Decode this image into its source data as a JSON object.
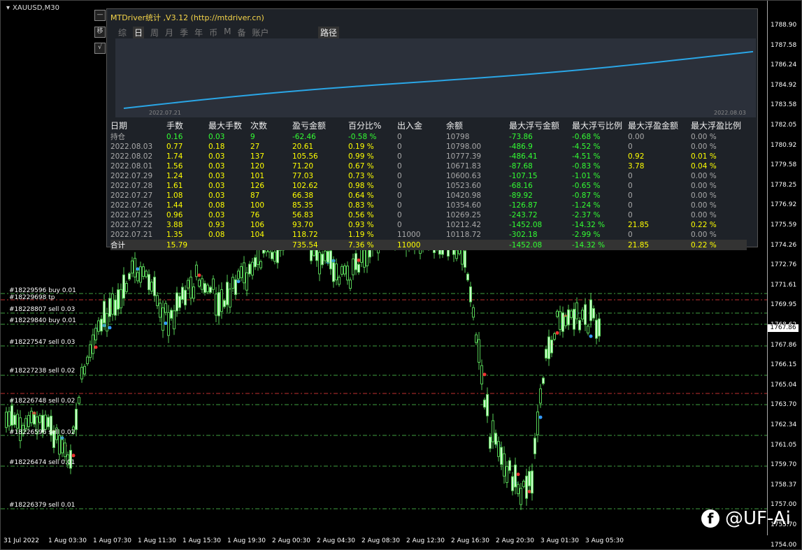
{
  "symbol": "XAUUSD,M30",
  "price_axis": [
    "1788.90",
    "1787.58",
    "1786.24",
    "1784.92",
    "1783.58",
    "1782.05",
    "1780.92",
    "1779.58",
    "1778.25",
    "1776.92",
    "1775.59",
    "1774.26",
    "1772.76",
    "1771.61",
    "1769.95",
    "1768.62",
    "1767.86",
    "1766.15",
    "1765.04",
    "1763.70",
    "1762.34",
    "1761.05",
    "1759.70",
    "1758.37",
    "1757.00",
    "1755.70",
    "1754.00"
  ],
  "current_price": "1767.86",
  "time_axis": [
    "31 Jul 2022",
    "1 Aug 03:30",
    "1 Aug 07:30",
    "1 Aug 11:30",
    "1 Aug 15:30",
    "1 Aug 19:30",
    "2 Aug 00:30",
    "2 Aug 04:30",
    "2 Aug 08:30",
    "2 Aug 12:30",
    "2 Aug 16:30",
    "2 Aug 20:30",
    "3 Aug 01:30",
    "3 Aug 05:30"
  ],
  "orders": [
    "#18229596 buy 0.01",
    "#18229698 tp",
    "#18228807 sell 0.03",
    "#18229840 buy 0.01",
    "#18227547 sell 0.03",
    "#18227238 sell 0.02",
    "#18226748 sell 0.02",
    "#18226596 sell 0.02",
    "#18226474 sell 0.01",
    "#18226379 sell 0.01"
  ],
  "watermark": "@UF-Ai",
  "watermark_icon": "facebook-icon",
  "panel": {
    "title": "MTDriver统计 ,V3.12 (http://mtdriver.cn)",
    "tabs": [
      "综",
      "日",
      "周",
      "月",
      "季",
      "年",
      "币",
      "M",
      "备",
      "账户"
    ],
    "active_tab": "日",
    "path_tab": "路径",
    "side_buttons": [
      "—",
      "移",
      "√"
    ],
    "graph_start": "2022.07.21",
    "graph_end": "2022.08.03",
    "headers": [
      "日期",
      "手数",
      "最大手数",
      "次数",
      "盈亏金额",
      "百分比%",
      "出入金",
      "余额",
      "最大浮亏金额",
      "最大浮亏比例",
      "最大浮盈金额",
      "最大浮盈比例"
    ],
    "rows": [
      [
        "持仓",
        "0.16",
        "0.03",
        "9",
        "-62.46",
        "-0.58 %",
        "0",
        "10798",
        "-73.86",
        "-0.68 %",
        "0.00",
        "0.00 %"
      ],
      [
        "2022.08.03",
        "0.77",
        "0.18",
        "27",
        "20.61",
        "0.19 %",
        "0",
        "10798.00",
        "-486.9",
        "-4.52 %",
        "0",
        "0.00 %"
      ],
      [
        "2022.08.02",
        "1.74",
        "0.03",
        "137",
        "105.56",
        "0.99 %",
        "0",
        "10777.39",
        "-486.41",
        "-4.51 %",
        "0.92",
        "0.01 %"
      ],
      [
        "2022.08.01",
        "1.56",
        "0.03",
        "120",
        "71.20",
        "0.67 %",
        "0",
        "10671.83",
        "-87.68",
        "-0.83 %",
        "3.78",
        "0.04 %"
      ],
      [
        "2022.07.29",
        "1.24",
        "0.03",
        "101",
        "77.03",
        "0.73 %",
        "0",
        "10600.63",
        "-107.15",
        "-1.01 %",
        "0",
        "0.00 %"
      ],
      [
        "2022.07.28",
        "1.61",
        "0.03",
        "126",
        "102.62",
        "0.98 %",
        "0",
        "10523.60",
        "-68.16",
        "-0.65 %",
        "0",
        "0.00 %"
      ],
      [
        "2022.07.27",
        "1.08",
        "0.03",
        "87",
        "66.38",
        "0.64 %",
        "0",
        "10420.98",
        "-89.92",
        "-0.87 %",
        "0",
        "0.00 %"
      ],
      [
        "2022.07.26",
        "1.44",
        "0.08",
        "100",
        "85.35",
        "0.83 %",
        "0",
        "10354.60",
        "-126.87",
        "-1.24 %",
        "0",
        "0.00 %"
      ],
      [
        "2022.07.25",
        "0.96",
        "0.03",
        "76",
        "56.83",
        "0.56 %",
        "0",
        "10269.25",
        "-243.72",
        "-2.37 %",
        "0",
        "0.00 %"
      ],
      [
        "2022.07.22",
        "3.88",
        "0.93",
        "106",
        "93.70",
        "0.93 %",
        "0",
        "10212.42",
        "-1452.08",
        "-14.32 %",
        "21.85",
        "0.22 %"
      ],
      [
        "2022.07.21",
        "1.35",
        "0.08",
        "104",
        "118.72",
        "1.19 %",
        "11000",
        "10118.72",
        "-302.18",
        "-2.99 %",
        "0",
        "0.00 %"
      ]
    ],
    "total": [
      "合计",
      "15.79",
      "",
      "",
      "735.54",
      "7.36 %",
      "11000",
      "",
      "-1452.08",
      "-14.32 %",
      "21.85",
      "0.22 %"
    ]
  },
  "colors": {
    "background": "#000000",
    "candle": "#ccffcc",
    "order_line": "#3fa03f",
    "panel": "#1e2228",
    "curve": "#2aa6e6",
    "accent": "#f5d54a"
  }
}
